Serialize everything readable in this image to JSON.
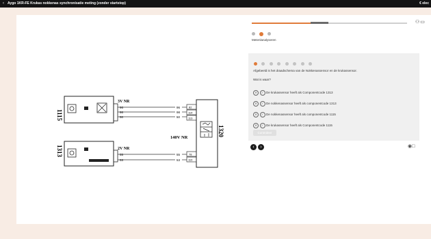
{
  "titlebar": {
    "back_icon": "‹",
    "title": "Aygo 1KR-FE Krukas nokkenas synchronisatie meting (zonder startstop)",
    "brand": "€ elec"
  },
  "diagram": {
    "component_1115": "1115",
    "component_1313": "1313",
    "component_1320": "1320",
    "label_3v": "3V NR",
    "label_2v": "2V NR",
    "label_140v": "140V NR",
    "pins_top_left": [
      "96",
      "98",
      "50"
    ],
    "pins_top_right": [
      "96",
      "98",
      "50"
    ],
    "boxes_top": [
      "82",
      "114",
      "113"
    ],
    "pins_bottom_left": [
      "55",
      "53"
    ],
    "pins_bottom_right": [
      "55",
      "53"
    ],
    "boxes_bottom": [
      "78",
      "110"
    ]
  },
  "panel": {
    "progress_percent": 45,
    "section_label": "Metenlanalyseren",
    "question_title": "Afgebeeld is het draadschema van de Nokkenassensor en de krukassensor.",
    "question_prompt": "Wat is waar?",
    "options": [
      "De krukassensor heeft als Componentcode 1313",
      "De nokkenassensor heeft als componentcode 1313",
      "De nokkenassensor heeft als componentcode 1115",
      "De krukassensor heeft als Componentcode 1115"
    ],
    "submit_label": "Controleer"
  },
  "colors": {
    "accent": "#e07b39",
    "titlebar": "#141414",
    "background": "#f8ece4"
  }
}
